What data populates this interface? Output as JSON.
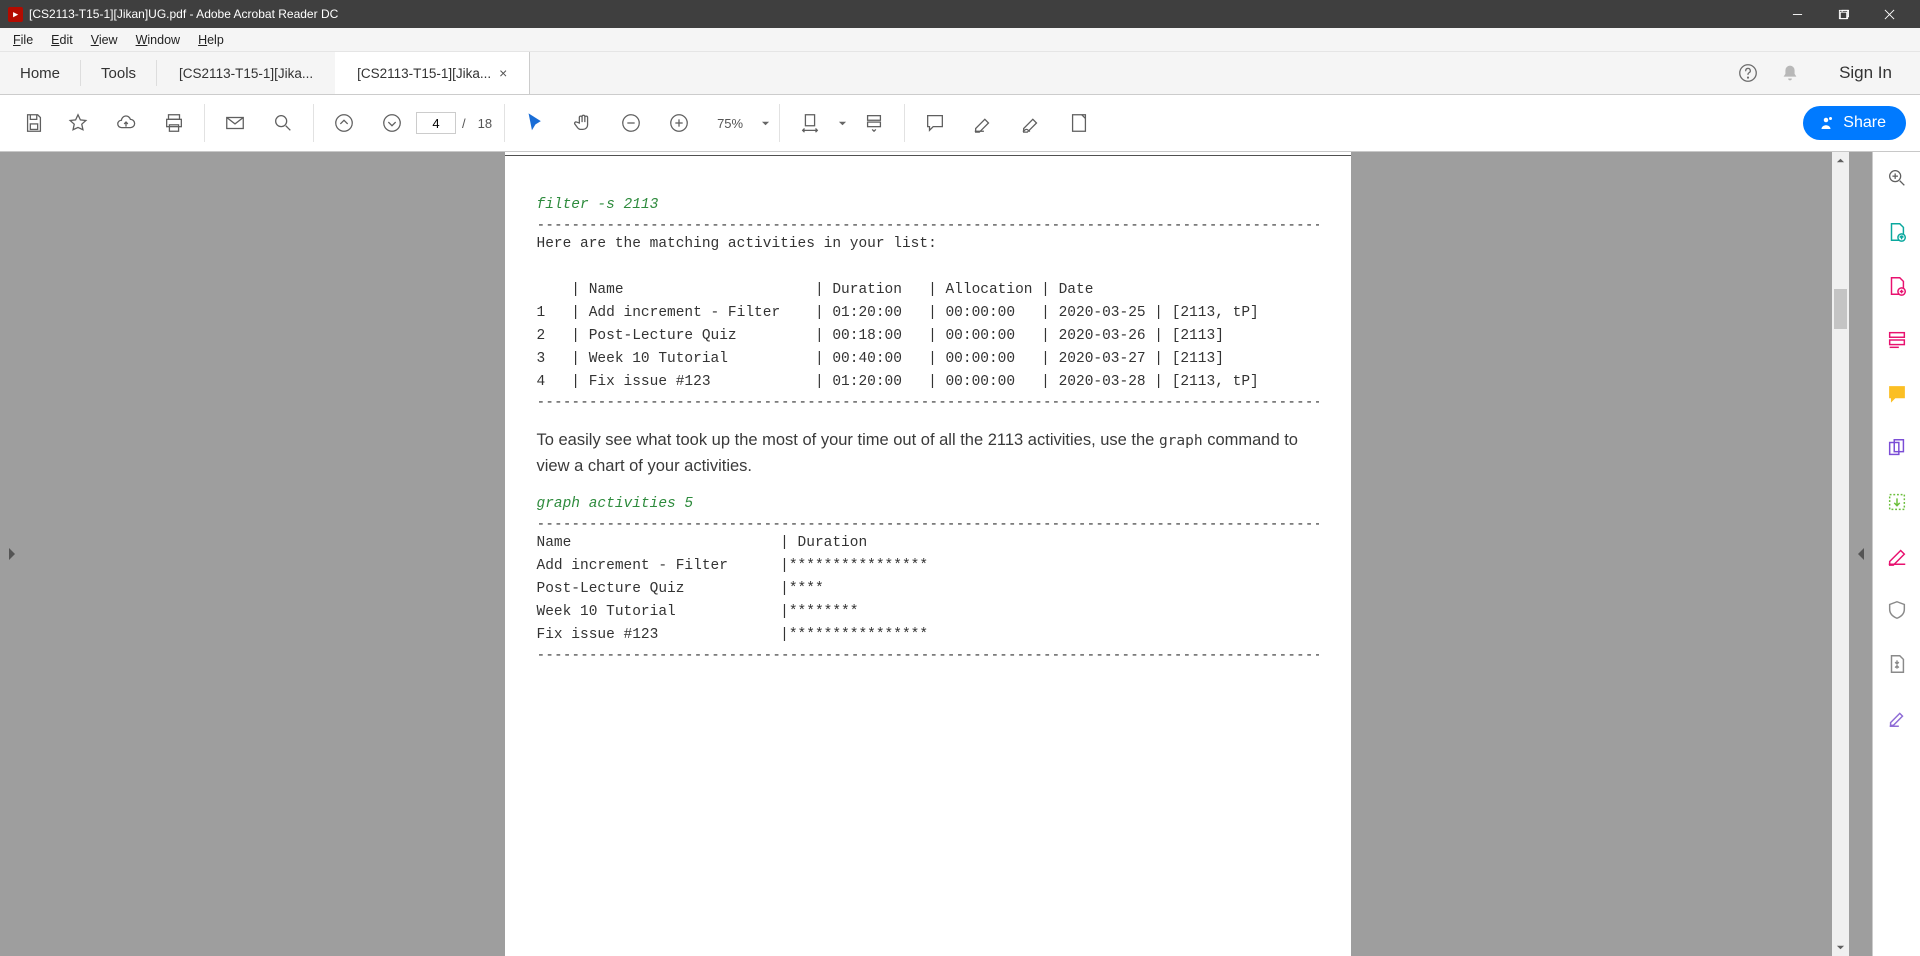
{
  "titlebar": {
    "pdf_badge": "▸",
    "title": "[CS2113-T15-1][Jikan]UG.pdf - Adobe Acrobat Reader DC"
  },
  "menubar": {
    "file": "File",
    "edit": "Edit",
    "view": "View",
    "window": "Window",
    "help": "Help",
    "ul": {
      "file": "F",
      "edit": "E",
      "view": "V",
      "window": "W",
      "help": "H"
    }
  },
  "tabrow": {
    "home": "Home",
    "tools": "Tools",
    "tab1": "[CS2113-T15-1][Jika...",
    "tab2": "[CS2113-T15-1][Jika...",
    "signin": "Sign In"
  },
  "toolbar": {
    "page_current": "4",
    "page_slash": "/",
    "page_total": "18",
    "zoom": "75%",
    "share": "Share"
  },
  "document": {
    "cmd1": "filter -s 2113",
    "dashes": "------------------------------------------------------------------------------------------------",
    "match_intro": "Here are the matching activities in your list:",
    "table_header": "    | Name                      | Duration   | Allocation | Date",
    "table_rows": [
      "1   | Add increment - Filter    | 01:20:00   | 00:00:00   | 2020-03-25 | [2113, tP]",
      "2   | Post-Lecture Quiz         | 00:18:00   | 00:00:00   | 2020-03-26 | [2113]",
      "3   | Week 10 Tutorial          | 00:40:00   | 00:00:00   | 2020-03-27 | [2113]",
      "4   | Fix issue #123            | 01:20:00   | 00:00:00   | 2020-03-28 | [2113, tP]"
    ],
    "body_pre": "To easily see what took up the most of your time out of all the 2113 activities, use the ",
    "body_code": "graph",
    "body_post": " command to view a chart of your activities.",
    "cmd2": "graph activities 5",
    "graph_header": "Name                        | Duration",
    "graph_rows": [
      "Add increment - Filter      |****************",
      "Post-Lecture Quiz           |****",
      "Week 10 Tutorial            |********",
      "Fix issue #123              |****************"
    ]
  }
}
